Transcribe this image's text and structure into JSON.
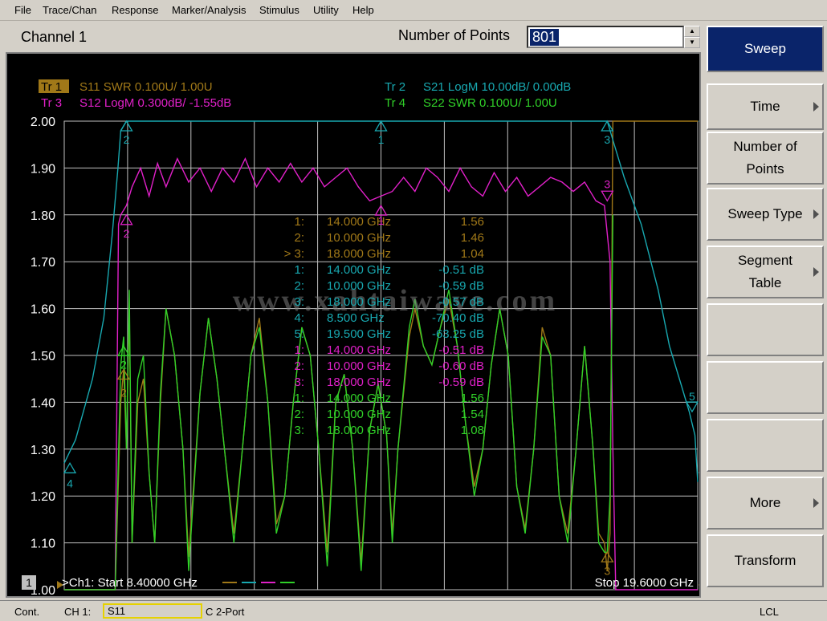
{
  "menu": [
    "File",
    "Trace/Chan",
    "Response",
    "Marker/Analysis",
    "Stimulus",
    "Utility",
    "Help"
  ],
  "header": {
    "channel_title": "Channel 1",
    "points_label": "Number of Points",
    "points_value": "801"
  },
  "colors": {
    "tr1": "#a07818",
    "tr2": "#18a8b0",
    "tr3": "#e020c8",
    "tr4": "#30d028",
    "grid": "#c0c0c0",
    "bg": "#000000"
  },
  "traces": [
    {
      "tag": "Tr 1",
      "desc": "S11 SWR 0.100U/  1.00U"
    },
    {
      "tag": "Tr 2",
      "desc": "S21 LogM 10.00dB/  0.00dB"
    },
    {
      "tag": "Tr 3",
      "desc": "S12 LogM 0.300dB/  -1.55dB"
    },
    {
      "tag": "Tr 4",
      "desc": "S22 SWR 0.100U/  1.00U"
    }
  ],
  "y_ticks": [
    "2.00",
    "1.90",
    "1.80",
    "1.70",
    "1.60",
    "1.50",
    "1.40",
    "1.30",
    "1.20",
    "1.10",
    "1.00"
  ],
  "markers_table": [
    {
      "id": "1:",
      "freq": "14.000 GHz",
      "value": "1.56",
      "trace": "tr1"
    },
    {
      "id": "2:",
      "freq": "10.000 GHz",
      "value": "1.46",
      "trace": "tr1"
    },
    {
      "id": "> 3:",
      "freq": "18.000 GHz",
      "value": "1.04",
      "trace": "tr1"
    },
    {
      "id": "1:",
      "freq": "14.000 GHz",
      "value": "-0.51 dB",
      "trace": "tr2"
    },
    {
      "id": "2:",
      "freq": "10.000 GHz",
      "value": "-0.59 dB",
      "trace": "tr2"
    },
    {
      "id": "3:",
      "freq": "18.000 GHz",
      "value": "-0.57 dB",
      "trace": "tr2"
    },
    {
      "id": "4:",
      "freq": "8.500 GHz",
      "value": "-70.40 dB",
      "trace": "tr2"
    },
    {
      "id": "5:",
      "freq": "19.500 GHz",
      "value": "-63.25 dB",
      "trace": "tr2"
    },
    {
      "id": "1:",
      "freq": "14.000 GHz",
      "value": "-0.51 dB",
      "trace": "tr3"
    },
    {
      "id": "2:",
      "freq": "10.000 GHz",
      "value": "-0.60 dB",
      "trace": "tr3"
    },
    {
      "id": "3:",
      "freq": "18.000 GHz",
      "value": "-0.59 dB",
      "trace": "tr3"
    },
    {
      "id": "1:",
      "freq": "14.000 GHz",
      "value": "1.56",
      "trace": "tr4"
    },
    {
      "id": "2:",
      "freq": "10.000 GHz",
      "value": "1.54",
      "trace": "tr4"
    },
    {
      "id": "3:",
      "freq": "18.000 GHz",
      "value": "1.08",
      "trace": "tr4"
    }
  ],
  "watermark": "www.xahtaiwave.com",
  "footer": {
    "channel_badge": "1",
    "start": ">Ch1: Start  8.40000 GHz",
    "stop": "Stop  19.6000 GHz"
  },
  "softkeys": [
    {
      "label": "Sweep",
      "active": true,
      "arrow": false
    },
    {
      "label": "Time",
      "active": false,
      "arrow": true
    },
    {
      "label": "Number of Points",
      "active": false,
      "arrow": false
    },
    {
      "label": "Sweep Type",
      "active": false,
      "arrow": true
    },
    {
      "label": "Segment Table",
      "active": false,
      "arrow": true
    },
    {
      "label": "",
      "active": false,
      "arrow": false
    },
    {
      "label": "",
      "active": false,
      "arrow": false
    },
    {
      "label": "",
      "active": false,
      "arrow": false
    },
    {
      "label": "More",
      "active": false,
      "arrow": true
    },
    {
      "label": "Transform",
      "active": false,
      "arrow": false
    }
  ],
  "status": {
    "mode": "Cont.",
    "channel": "CH 1:",
    "param": "S11",
    "cal": "C  2-Port",
    "remote": "LCL"
  },
  "chart_data": {
    "type": "line",
    "x_range_ghz": [
      8.4,
      19.6
    ],
    "ylim": [
      1.0,
      2.0
    ],
    "grid": true,
    "series": [
      {
        "name": "Tr 1 S11 SWR",
        "trace": "tr1",
        "x": [
          8.4,
          9.3,
          9.4,
          9.45,
          9.5,
          9.55,
          9.6,
          9.7,
          9.8,
          9.9,
          10.0,
          10.1,
          10.2,
          10.35,
          10.5,
          10.6,
          10.8,
          10.95,
          11.1,
          11.25,
          11.4,
          11.55,
          11.7,
          11.85,
          12.0,
          12.15,
          12.3,
          12.45,
          12.6,
          12.75,
          12.9,
          13.05,
          13.2,
          13.35,
          13.5,
          13.65,
          13.8,
          13.95,
          14.1,
          14.2,
          14.3,
          14.5,
          14.6,
          14.75,
          14.9,
          15.05,
          15.2,
          15.35,
          15.5,
          15.65,
          15.8,
          15.95,
          16.1,
          16.25,
          16.4,
          16.55,
          16.7,
          16.85,
          17.0,
          17.15,
          17.3,
          17.45,
          17.6,
          17.75,
          17.85,
          17.95,
          18.0,
          18.05,
          18.1,
          19.6
        ],
        "y": [
          1.0,
          1.0,
          1.4,
          1.47,
          1.3,
          1.6,
          1.1,
          1.4,
          1.45,
          1.25,
          1.1,
          1.4,
          1.6,
          1.5,
          1.3,
          1.07,
          1.42,
          1.58,
          1.45,
          1.28,
          1.12,
          1.3,
          1.5,
          1.58,
          1.4,
          1.14,
          1.2,
          1.4,
          1.56,
          1.5,
          1.3,
          1.08,
          1.4,
          1.46,
          1.3,
          1.06,
          1.34,
          1.44,
          1.33,
          1.12,
          1.3,
          1.54,
          1.6,
          1.52,
          1.48,
          1.56,
          1.62,
          1.52,
          1.35,
          1.22,
          1.3,
          1.48,
          1.6,
          1.5,
          1.22,
          1.13,
          1.3,
          1.56,
          1.5,
          1.2,
          1.12,
          1.3,
          1.52,
          1.3,
          1.12,
          1.1,
          1.04,
          1.12,
          2.0,
          2.0
        ]
      },
      {
        "name": "Tr 2 S21 LogM",
        "trace": "tr2",
        "x": [
          8.4,
          8.6,
          8.9,
          9.1,
          9.25,
          9.35,
          9.4,
          9.5,
          10.0,
          11.0,
          12.0,
          13.0,
          14.0,
          15.0,
          16.0,
          17.0,
          17.9,
          18.0,
          18.1,
          18.3,
          18.6,
          18.9,
          19.1,
          19.3,
          19.45,
          19.55,
          19.6
        ],
        "y": [
          1.27,
          1.32,
          1.45,
          1.58,
          1.76,
          1.9,
          1.98,
          2.0,
          2.0,
          2.0,
          2.0,
          2.0,
          2.0,
          2.0,
          2.0,
          2.0,
          2.0,
          2.0,
          1.96,
          1.88,
          1.78,
          1.64,
          1.52,
          1.44,
          1.38,
          1.33,
          1.23
        ]
      },
      {
        "name": "Tr 3 S12 LogM",
        "trace": "tr3",
        "x": [
          8.4,
          9.3,
          9.36,
          9.4,
          9.5,
          9.6,
          9.75,
          9.9,
          10.05,
          10.2,
          10.4,
          10.6,
          10.8,
          11.0,
          11.2,
          11.4,
          11.6,
          11.8,
          12.0,
          12.2,
          12.4,
          12.6,
          12.8,
          13.0,
          13.2,
          13.4,
          13.6,
          13.8,
          14.0,
          14.2,
          14.4,
          14.6,
          14.8,
          15.0,
          15.2,
          15.4,
          15.6,
          15.8,
          16.0,
          16.2,
          16.4,
          16.6,
          16.8,
          17.0,
          17.2,
          17.4,
          17.6,
          17.8,
          17.95,
          18.05,
          18.1,
          18.15,
          19.6
        ],
        "y": [
          1.0,
          1.0,
          1.78,
          1.8,
          1.82,
          1.86,
          1.9,
          1.84,
          1.91,
          1.86,
          1.92,
          1.87,
          1.9,
          1.85,
          1.9,
          1.87,
          1.92,
          1.86,
          1.9,
          1.87,
          1.91,
          1.87,
          1.9,
          1.86,
          1.88,
          1.9,
          1.86,
          1.83,
          1.84,
          1.85,
          1.88,
          1.85,
          1.9,
          1.88,
          1.85,
          1.9,
          1.86,
          1.84,
          1.89,
          1.85,
          1.88,
          1.84,
          1.86,
          1.88,
          1.87,
          1.85,
          1.87,
          1.83,
          1.82,
          1.7,
          1.3,
          1.0,
          1.0
        ]
      },
      {
        "name": "Tr 4 S22 SWR",
        "trace": "tr4",
        "x": [
          8.4,
          9.3,
          9.4,
          9.45,
          9.5,
          9.55,
          9.6,
          9.7,
          9.8,
          9.9,
          10.0,
          10.1,
          10.2,
          10.35,
          10.5,
          10.6,
          10.8,
          10.95,
          11.1,
          11.25,
          11.4,
          11.55,
          11.7,
          11.85,
          12.0,
          12.15,
          12.3,
          12.45,
          12.6,
          12.75,
          12.9,
          13.05,
          13.2,
          13.35,
          13.5,
          13.65,
          13.8,
          13.95,
          14.1,
          14.2,
          14.3,
          14.5,
          14.6,
          14.75,
          14.9,
          15.05,
          15.2,
          15.35,
          15.5,
          15.65,
          15.8,
          15.95,
          16.1,
          16.25,
          16.4,
          16.55,
          16.7,
          16.85,
          17.0,
          17.15,
          17.3,
          17.45,
          17.6,
          17.75,
          17.85,
          17.95,
          18.0,
          18.05,
          18.1
        ],
        "y": [
          1.0,
          1.0,
          1.48,
          1.54,
          1.3,
          1.64,
          1.1,
          1.45,
          1.5,
          1.25,
          1.1,
          1.42,
          1.6,
          1.5,
          1.3,
          1.04,
          1.42,
          1.58,
          1.45,
          1.28,
          1.1,
          1.3,
          1.5,
          1.56,
          1.4,
          1.12,
          1.2,
          1.4,
          1.56,
          1.5,
          1.3,
          1.05,
          1.4,
          1.46,
          1.3,
          1.04,
          1.34,
          1.44,
          1.33,
          1.1,
          1.3,
          1.56,
          1.62,
          1.52,
          1.48,
          1.56,
          1.64,
          1.52,
          1.35,
          1.2,
          1.3,
          1.48,
          1.6,
          1.5,
          1.22,
          1.12,
          1.3,
          1.54,
          1.5,
          1.2,
          1.1,
          1.3,
          1.52,
          1.3,
          1.1,
          1.08,
          1.08,
          1.2,
          1.8
        ]
      }
    ]
  }
}
